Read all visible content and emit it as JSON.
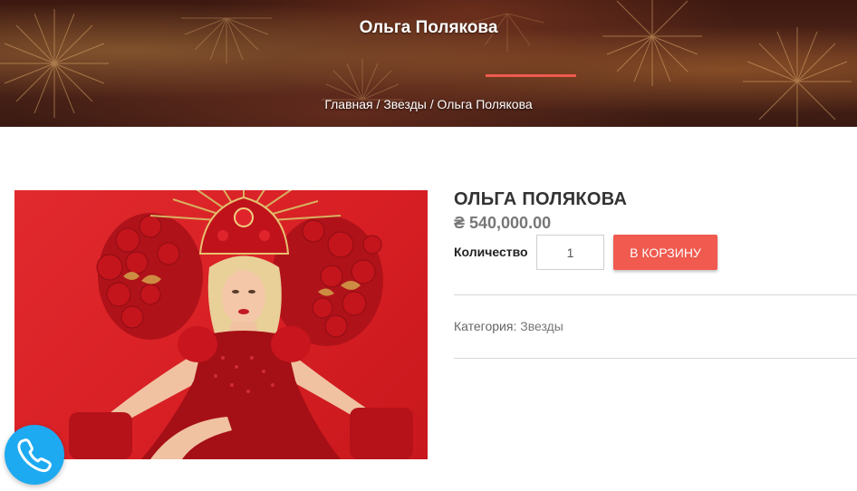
{
  "hero": {
    "title": "Ольга Полякова",
    "breadcrumb": {
      "home": "Главная",
      "separator": " / ",
      "category": "Звезды",
      "current": "Ольга Полякова"
    },
    "accent_color": "#ef5a4d"
  },
  "product": {
    "title": "ОЛЬГА ПОЛЯКОВА",
    "price": "₴ 540,000.00",
    "quantity_label": "Количество",
    "quantity_value": "1",
    "add_to_cart_label": "В КОРЗИНУ",
    "category_label": "Категория:",
    "category_value": "Звезды",
    "button_color": "#f05a4f"
  },
  "call_widget": {
    "icon": "phone-icon",
    "color": "#1eaaf1"
  }
}
